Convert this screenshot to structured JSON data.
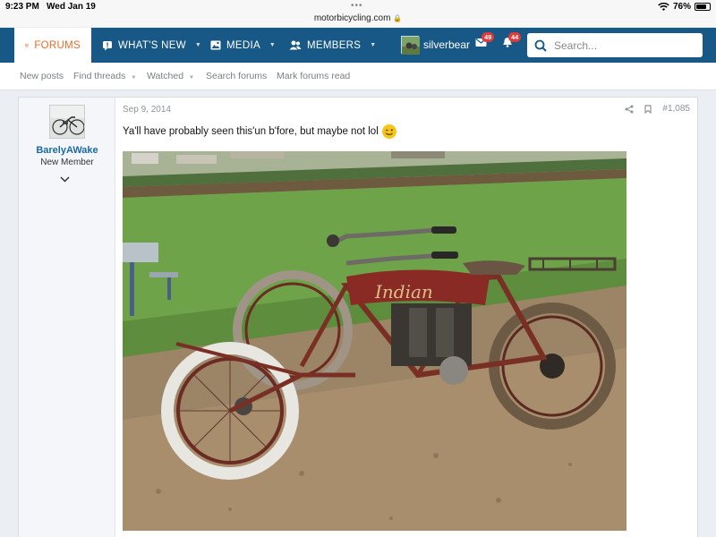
{
  "status_bar": {
    "time": "9:23 PM",
    "date": "Wed Jan 19",
    "url": "motorbicycling.com",
    "battery": "76%",
    "battery_level": 0.76
  },
  "nav": {
    "tabs": [
      {
        "label": "FORUMS",
        "icon": "forums-icon"
      },
      {
        "label": "WHAT'S NEW",
        "icon": "whats-new-icon"
      },
      {
        "label": "MEDIA",
        "icon": "media-icon"
      },
      {
        "label": "MEMBERS",
        "icon": "members-icon"
      }
    ],
    "username": "silverbear",
    "inbox_count": "49",
    "alerts_count": "44",
    "search_placeholder": "Search..."
  },
  "subnav": {
    "items": [
      "New posts",
      "Find threads",
      "Watched",
      "Search forums",
      "Mark forums read"
    ]
  },
  "post": {
    "author": "BarelyAWake",
    "author_title": "New Member",
    "date": "Sep 9, 2014",
    "post_number": "#1,085",
    "text": "Ya'll have probably seen this'un b'fore, but maybe not lol",
    "image_subject": "antique-indian-motorcycle-sidecar"
  },
  "colors": {
    "nav_bg": "#185886",
    "accent": "#ea6a2b",
    "link": "#1b6aa5",
    "badge": "#e03b3b"
  }
}
